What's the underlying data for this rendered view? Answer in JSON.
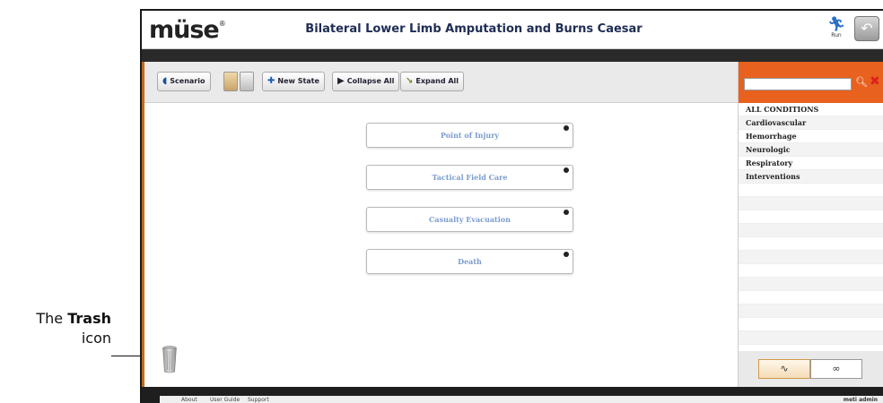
{
  "annotation": {
    "prefix": "The",
    "bold": "Trash",
    "suffix": "icon"
  },
  "app": {
    "logo": "müse",
    "logo_mark": "®",
    "title": "Bilateral Lower Limb Amputation and Burns Caesar",
    "run_label": "Run",
    "back_icon": "undo-icon"
  },
  "toolbar": {
    "scenario_label": "Scenario",
    "new_state_label": "New State",
    "collapse_all_label": "Collapse All",
    "expand_all_label": "Expand All"
  },
  "states": [
    {
      "label": "Point of Injury"
    },
    {
      "label": "Tactical Field Care"
    },
    {
      "label": "Casualty Evacuation"
    },
    {
      "label": "Death"
    }
  ],
  "conditions_panel": {
    "search_value": "",
    "items": [
      "ALL CONDITIONS",
      "Cardiovascular",
      "Hemorrhage",
      "Neurologic",
      "Respiratory",
      "Interventions"
    ]
  },
  "footer": {
    "links": [
      "About",
      "User Guide",
      "Support"
    ],
    "user": "meti admin"
  },
  "colors": {
    "accent_orange": "#e8611f",
    "state_text": "#7b9ccf",
    "title_text": "#1f2d55"
  }
}
